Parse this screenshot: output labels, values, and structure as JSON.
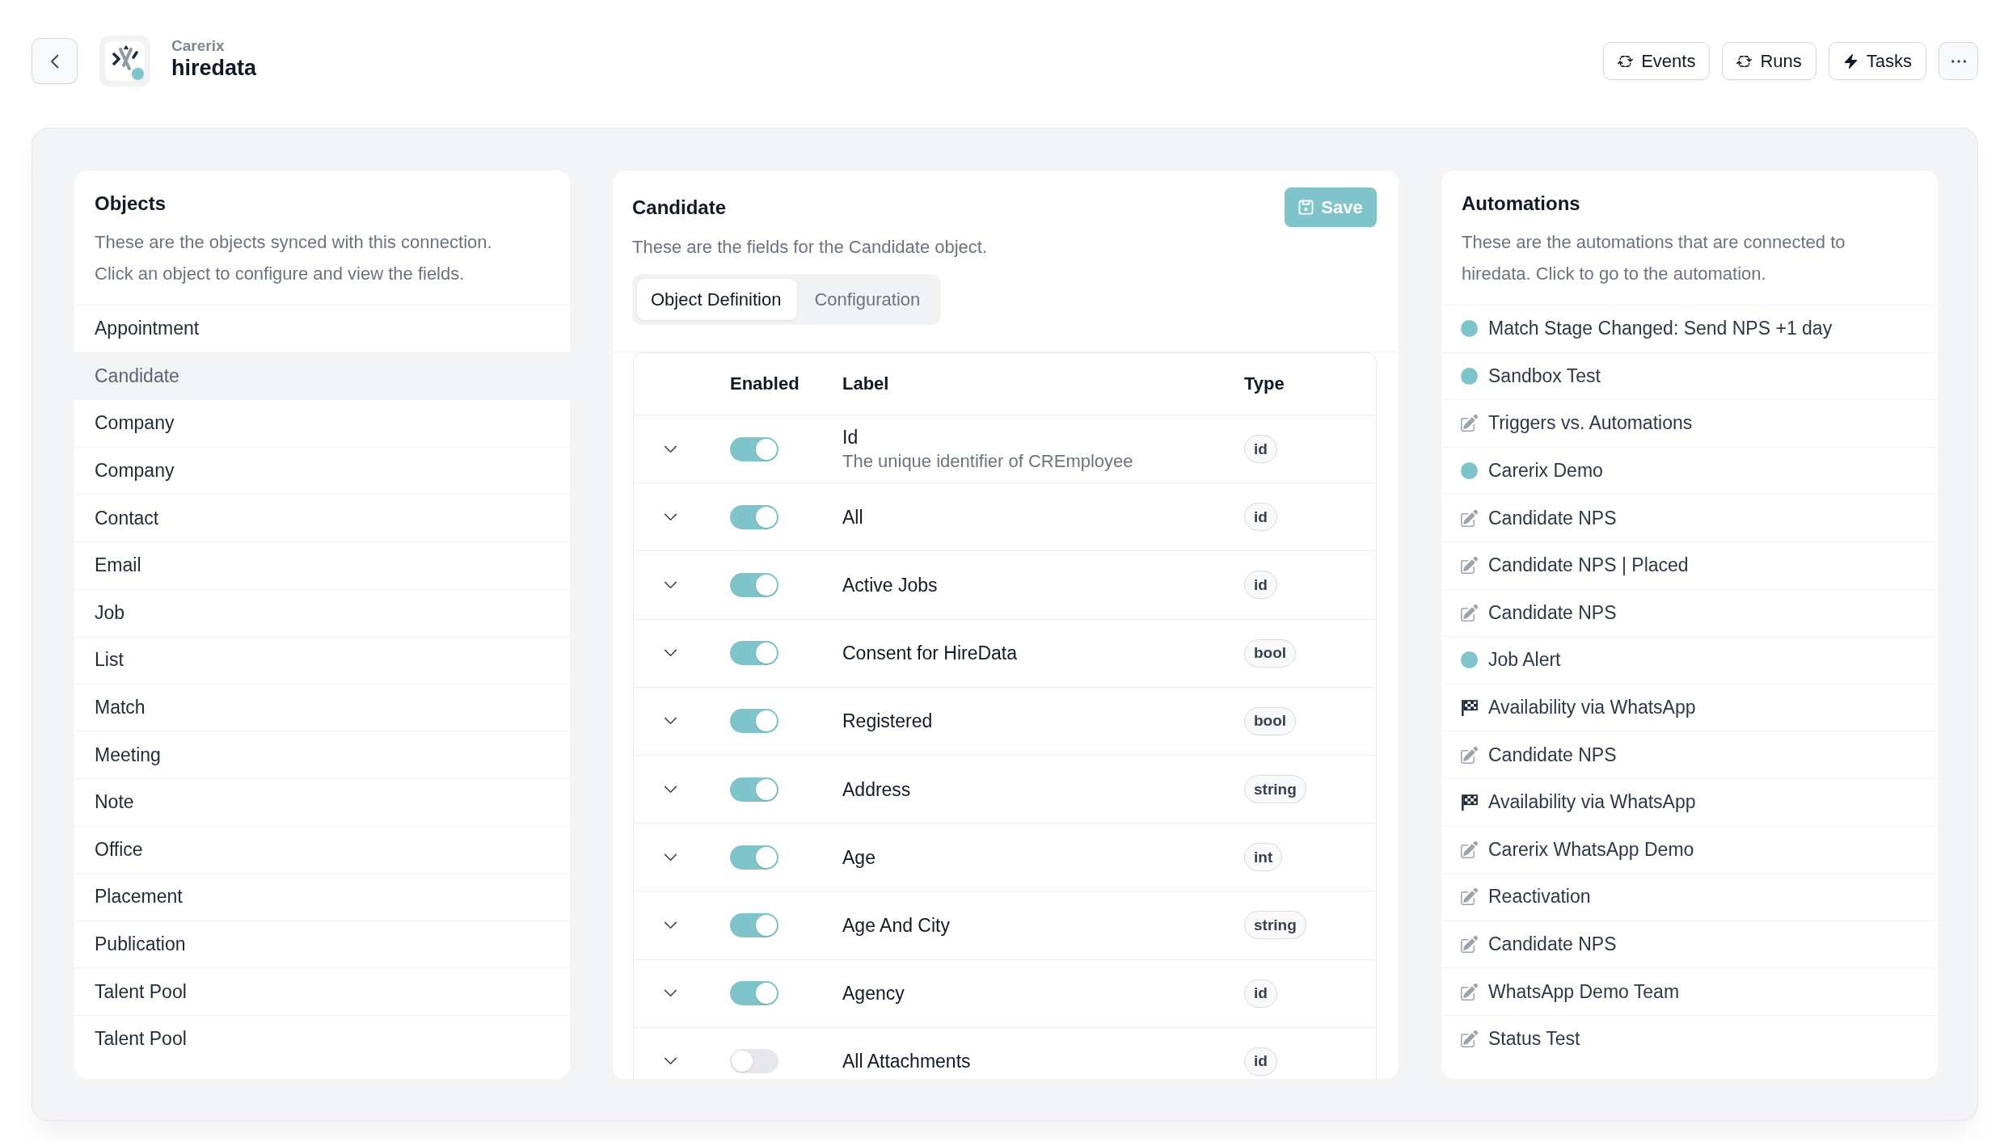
{
  "header": {
    "vendor": "Carerix",
    "connection": "hiredata",
    "actions": [
      {
        "kind": "cycle",
        "label": "Events"
      },
      {
        "kind": "cycle",
        "label": "Runs"
      },
      {
        "kind": "bolt",
        "label": "Tasks"
      }
    ]
  },
  "objects": {
    "title": "Objects",
    "description": "These are the objects synced with this connection. Click an object to configure and view the fields.",
    "items": [
      {
        "label": "Appointment",
        "selected": false
      },
      {
        "label": "Candidate",
        "selected": true
      },
      {
        "label": "Company",
        "selected": false
      },
      {
        "label": "Company",
        "selected": false
      },
      {
        "label": "Contact",
        "selected": false
      },
      {
        "label": "Email",
        "selected": false
      },
      {
        "label": "Job",
        "selected": false
      },
      {
        "label": "List",
        "selected": false
      },
      {
        "label": "Match",
        "selected": false
      },
      {
        "label": "Meeting",
        "selected": false
      },
      {
        "label": "Note",
        "selected": false
      },
      {
        "label": "Office",
        "selected": false
      },
      {
        "label": "Placement",
        "selected": false
      },
      {
        "label": "Publication",
        "selected": false
      },
      {
        "label": "Talent Pool",
        "selected": false
      },
      {
        "label": "Talent Pool",
        "selected": false
      }
    ]
  },
  "editor": {
    "title": "Candidate",
    "save_button": "Save",
    "description": "These are the fields for the Candidate object.",
    "tabs": [
      {
        "label": "Object Definition",
        "selected": true
      },
      {
        "label": "Configuration",
        "selected": false
      }
    ],
    "table": {
      "columns": [
        "Enabled",
        "Label",
        "Type"
      ],
      "rows": [
        {
          "enabled": true,
          "label": "Id",
          "description": "The unique identifier of CREmployee",
          "type": "id"
        },
        {
          "enabled": true,
          "label": "All",
          "type": "id"
        },
        {
          "enabled": true,
          "label": "Active Jobs",
          "type": "id"
        },
        {
          "enabled": true,
          "label": "Consent for HireData",
          "type": "bool"
        },
        {
          "enabled": true,
          "label": "Registered",
          "type": "bool"
        },
        {
          "enabled": true,
          "label": "Address",
          "type": "string"
        },
        {
          "enabled": true,
          "label": "Age",
          "type": "int"
        },
        {
          "enabled": true,
          "label": "Age And City",
          "type": "string"
        },
        {
          "enabled": true,
          "label": "Agency",
          "type": "id"
        },
        {
          "enabled": false,
          "label": "All Attachments",
          "type": "id"
        }
      ]
    }
  },
  "automations": {
    "title": "Automations",
    "description": "These are the automations that are connected to hiredata. Click to go to the automation.",
    "items": [
      {
        "kind": "dot",
        "label": "Match Stage Changed: Send NPS +1 day"
      },
      {
        "kind": "dot",
        "label": "Sandbox Test"
      },
      {
        "kind": "edit",
        "label": "Triggers vs. Automations"
      },
      {
        "kind": "dot",
        "label": "Carerix Demo"
      },
      {
        "kind": "edit",
        "label": "Candidate NPS"
      },
      {
        "kind": "edit",
        "label": "Candidate NPS | Placed"
      },
      {
        "kind": "edit",
        "label": "Candidate NPS"
      },
      {
        "kind": "dot",
        "label": "Job Alert"
      },
      {
        "kind": "flag",
        "label": "Availability via WhatsApp"
      },
      {
        "kind": "edit",
        "label": "Candidate NPS"
      },
      {
        "kind": "flag",
        "label": "Availability via WhatsApp"
      },
      {
        "kind": "edit",
        "label": "Carerix WhatsApp Demo"
      },
      {
        "kind": "edit",
        "label": "Reactivation"
      },
      {
        "kind": "edit",
        "label": "Candidate NPS"
      },
      {
        "kind": "edit",
        "label": "WhatsApp Demo Team"
      },
      {
        "kind": "edit",
        "label": "Status Test"
      }
    ]
  }
}
